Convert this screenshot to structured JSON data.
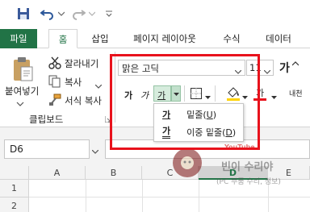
{
  "qat": {
    "save_icon": "save-icon",
    "undo_icon": "undo-icon",
    "redo_icon": "redo-icon"
  },
  "tabs": [
    {
      "label": "파일"
    },
    {
      "label": "홈"
    },
    {
      "label": "삽입"
    },
    {
      "label": "페이지 레이아웃"
    },
    {
      "label": "수식"
    },
    {
      "label": "데이터"
    }
  ],
  "clipboard": {
    "paste": "붙여넣기",
    "cut": "잘라내기",
    "copy": "복사",
    "format_painter": "서식 복사",
    "group_label": "클립보드"
  },
  "font": {
    "name": "맑은 고딕",
    "size": "11",
    "bold": "가",
    "italic": "가",
    "underline": "가",
    "grow": "가",
    "font_color_glyph": "가",
    "wrap_glyph": "내천"
  },
  "underline_menu": {
    "items": [
      {
        "glyph": "가",
        "label": "밑줄(",
        "key": "U",
        "end": ")"
      },
      {
        "glyph": "가",
        "label": "이중 밑줄(",
        "key": "D",
        "end": ")"
      }
    ]
  },
  "name_box": {
    "value": "D6"
  },
  "columns": [
    "A",
    "B",
    "C",
    "D",
    "E"
  ],
  "rows": [
    "1",
    "2"
  ],
  "watermark": {
    "line1": "빈이 수리야",
    "line2": "(PC 부품 수리, 정보)",
    "yt": "YouTube"
  },
  "colors": {
    "accent": "#217346",
    "highlight": "#e8121c",
    "font_color_bar": "#e8121c"
  }
}
